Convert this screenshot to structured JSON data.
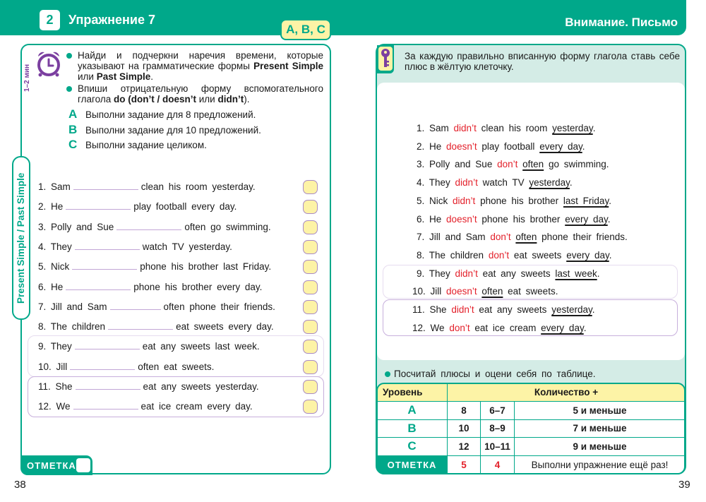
{
  "header": {
    "exercise_number": "2",
    "exercise_title": "Упражнение 7",
    "levels_badge": "A, B, C",
    "right_title": "Внимание. Письмо"
  },
  "left_page": {
    "time_label": "1–2 мин",
    "side_tab": "Present Simple / Past Simple",
    "instructions": [
      {
        "parts": [
          {
            "t": "Найди и подчеркни наречия времени, которые указывают на грамматические формы ",
            "b": false
          },
          {
            "t": "Present Simple",
            "b": true
          },
          {
            "t": " или ",
            "b": false
          },
          {
            "t": "Past Simple",
            "b": true
          },
          {
            "t": ".",
            "b": false
          }
        ]
      },
      {
        "parts": [
          {
            "t": "Впиши отрицательную форму вспомогательного глагола ",
            "b": false
          },
          {
            "t": "do (don’t / doesn’t",
            "b": true
          },
          {
            "t": " или ",
            "b": false
          },
          {
            "t": "didn’t",
            "b": true
          },
          {
            "t": ").",
            "b": false
          }
        ]
      }
    ],
    "levels": [
      {
        "letter": "A",
        "text": "Выполни задание для 8 предложений."
      },
      {
        "letter": "B",
        "text": "Выполни задание для 10 предложений."
      },
      {
        "letter": "C",
        "text": "Выполни задание целиком."
      }
    ],
    "sentences": [
      {
        "before": "1. Sam",
        "after": "clean his room yesterday."
      },
      {
        "before": "2. He",
        "after": "play football every day."
      },
      {
        "before": "3. Polly and Sue",
        "after": "often go swimming."
      },
      {
        "before": "4. They",
        "after": "watch TV yesterday."
      },
      {
        "before": "5. Nick",
        "after": "phone his brother last Friday."
      },
      {
        "before": "6. He",
        "after": "phone his brother every day."
      },
      {
        "before": "7. Jill and Sam",
        "after": "often phone their friends."
      },
      {
        "before": "8. The children",
        "after": "eat sweets every day."
      },
      {
        "before": "9. They",
        "after": "eat any sweets last week."
      },
      {
        "before": "10. Jill",
        "after": "often eat sweets."
      },
      {
        "before": "11. She",
        "after": "eat any sweets yesterday."
      },
      {
        "before": "12. We",
        "after": "eat ice cream every day."
      }
    ],
    "mark_label": "ОТМЕТКА",
    "page_number": "38"
  },
  "right_page": {
    "instruction": "За каждую правильно вписанную форму глагола ставь себе плюс в жёлтую клеточку.",
    "answers": [
      {
        "num": "1.",
        "subj": "Sam",
        "neg": "didn’t",
        "mid": "clean his room",
        "adv": "yesterday",
        "end": "",
        "adv_first": false
      },
      {
        "num": "2.",
        "subj": "He",
        "neg": "doesn’t",
        "mid": "play football",
        "adv": "every day",
        "end": "",
        "adv_first": false
      },
      {
        "num": "3.",
        "subj": "Polly and Sue",
        "neg": "don’t",
        "mid": "",
        "adv": "often",
        "end": "go swimming",
        "adv_first": true
      },
      {
        "num": "4.",
        "subj": "They",
        "neg": "didn’t",
        "mid": "watch TV",
        "adv": "yesterday",
        "end": "",
        "adv_first": false
      },
      {
        "num": "5.",
        "subj": "Nick",
        "neg": "didn’t",
        "mid": "phone his brother",
        "adv": "last Friday",
        "end": "",
        "adv_first": false
      },
      {
        "num": "6.",
        "subj": "He",
        "neg": "doesn’t",
        "mid": "phone his brother",
        "adv": "every day",
        "end": "",
        "adv_first": false
      },
      {
        "num": "7.",
        "subj": "Jill and Sam",
        "neg": "don’t",
        "mid": "",
        "adv": "often",
        "end": "phone their friends",
        "adv_first": true
      },
      {
        "num": "8.",
        "subj": "The children",
        "neg": "don’t",
        "mid": "eat sweets",
        "adv": "every day",
        "end": "",
        "adv_first": false
      },
      {
        "num": "9.",
        "subj": "They",
        "neg": "didn’t",
        "mid": "eat any sweets",
        "adv": "last week",
        "end": "",
        "adv_first": false
      },
      {
        "num": "10.",
        "subj": "Jill",
        "neg": "doesn’t",
        "mid": "",
        "adv": "often",
        "end": "eat sweets",
        "adv_first": true
      },
      {
        "num": "11.",
        "subj": "She",
        "neg": "didn’t",
        "mid": "eat any sweets",
        "adv": "yesterday",
        "end": "",
        "adv_first": false
      },
      {
        "num": "12.",
        "subj": "We",
        "neg": "don’t",
        "mid": "eat ice cream",
        "adv": "every day",
        "end": "",
        "adv_first": false
      }
    ],
    "count_instruction": "Посчитай плюсы и оцени себя по таблице.",
    "table": {
      "header_level": "Уровень",
      "header_count": "Количество +",
      "rows": [
        {
          "level": "A",
          "c5": "8",
          "c4": "6–7",
          "retry": "5 и меньше"
        },
        {
          "level": "B",
          "c5": "10",
          "c4": "8–9",
          "retry": "7 и меньше"
        },
        {
          "level": "C",
          "c5": "12",
          "c4": "10–11",
          "retry": "9 и меньше"
        }
      ],
      "mark_label": "ОТМЕТКА",
      "mark_5": "5",
      "mark_4": "4",
      "retry_text": "Выполни упражнение ещё раз!"
    },
    "page_number": "39"
  },
  "colors": {
    "brand_green": "#00a88a",
    "highlight_yellow": "#fdf3a6",
    "accent_purple": "#7b3fa0",
    "answer_red": "#e3202a"
  }
}
